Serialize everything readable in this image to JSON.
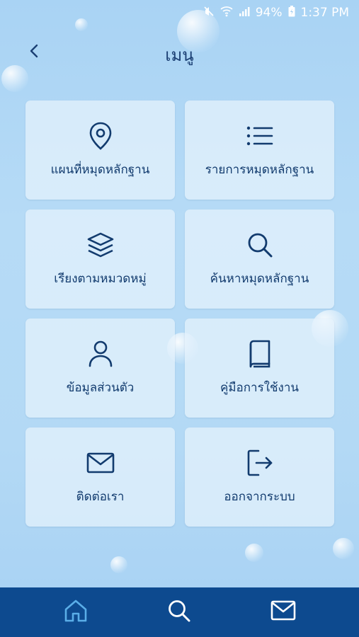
{
  "status_bar": {
    "battery": "94%",
    "time": "1:37 PM",
    "icons": [
      "mute-icon",
      "wifi-icon",
      "signal-icon",
      "battery-icon"
    ]
  },
  "header": {
    "title": "เมนู",
    "back_icon": "chevron-left-icon"
  },
  "menu": {
    "items": [
      {
        "label": "แผนที่หมุดหลักฐาน",
        "icon": "map-pin-icon"
      },
      {
        "label": "รายการหมุดหลักฐาน",
        "icon": "list-icon"
      },
      {
        "label": "เรียงตามหมวดหมู่",
        "icon": "layers-icon"
      },
      {
        "label": "ค้นหาหมุดหลักฐาน",
        "icon": "search-icon"
      },
      {
        "label": "ข้อมูลส่วนตัว",
        "icon": "user-icon"
      },
      {
        "label": "คู่มือการใช้งาน",
        "icon": "book-icon"
      },
      {
        "label": "ติดต่อเรา",
        "icon": "mail-icon"
      },
      {
        "label": "ออกจากระบบ",
        "icon": "logout-icon"
      }
    ]
  },
  "bottom_nav": {
    "items": [
      "home-icon",
      "search-icon",
      "mail-icon"
    ],
    "active_color": "#5aaee8",
    "inactive_color": "#ffffff",
    "background": "#0d4a8f"
  },
  "colors": {
    "accent": "#123b6e",
    "tile_bg": "rgba(230,243,252,0.72)"
  }
}
